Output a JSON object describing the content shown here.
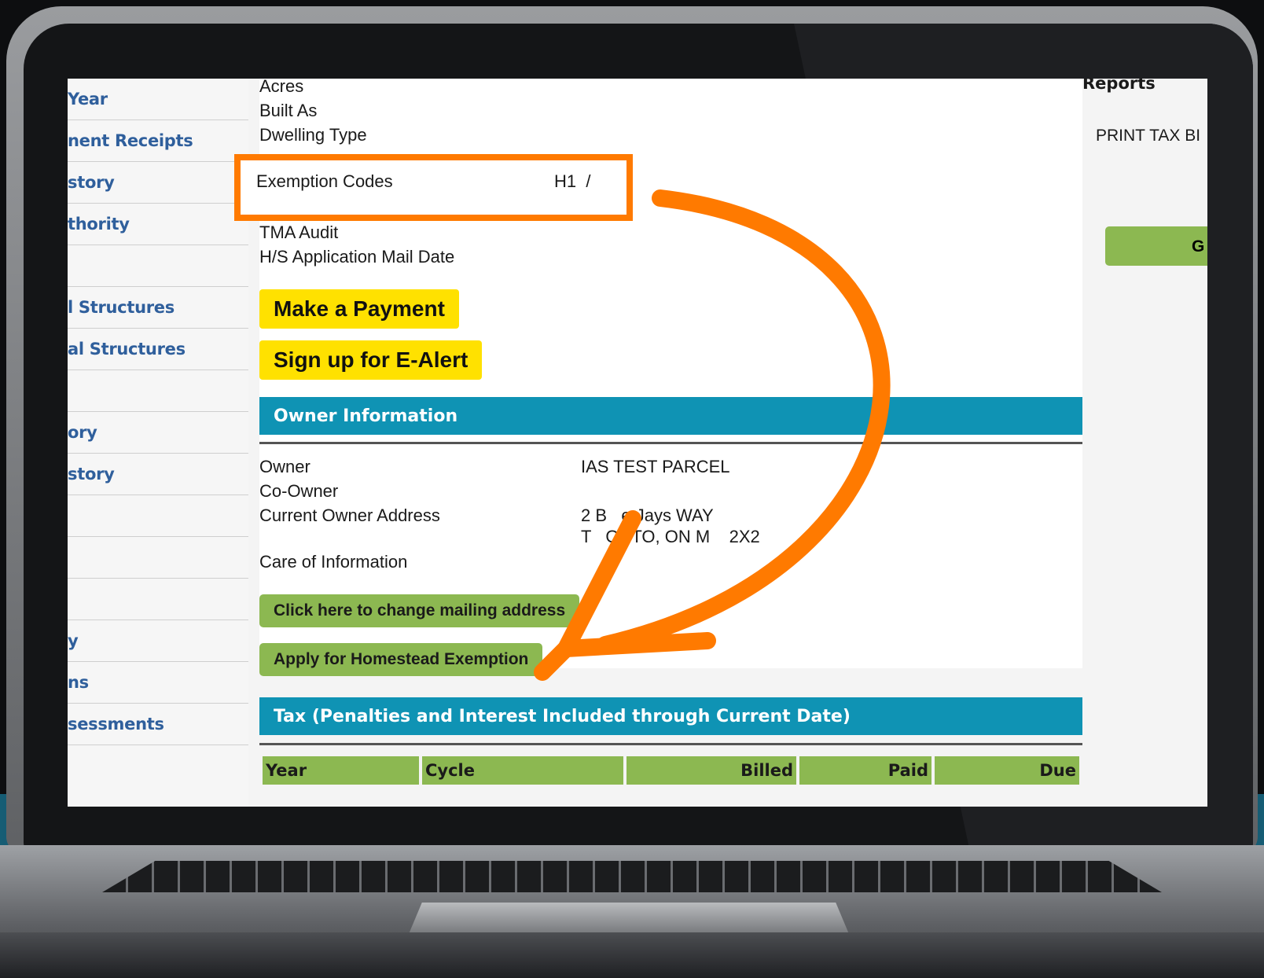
{
  "sidebar": {
    "items": [
      {
        "label": "Year"
      },
      {
        "label": "nent Receipts"
      },
      {
        "label": "story"
      },
      {
        "label": "thority"
      },
      {
        "label": ""
      },
      {
        "label": "l Structures"
      },
      {
        "label": "al Structures"
      },
      {
        "label": ""
      },
      {
        "label": "ory"
      },
      {
        "label": "story"
      },
      {
        "label": ""
      },
      {
        "label": ""
      },
      {
        "label": ""
      },
      {
        "label": "y"
      },
      {
        "label": "ns"
      },
      {
        "label": "sessments"
      }
    ]
  },
  "property": {
    "acres_label": "Acres",
    "built_as_label": "Built As",
    "dwelling_type_label": "Dwelling Type",
    "exemption_codes_label": "Exemption Codes",
    "exemption_codes_value": "H1  /",
    "tma_audit_label": "TMA Audit",
    "hs_mail_date_label": "H/S Application Mail Date"
  },
  "buttons": {
    "make_payment": "Make a Payment",
    "sign_up_ealert": "Sign up for E-Alert",
    "change_mailing": "Click here to change mailing address",
    "apply_homestead": "Apply for Homestead Exemption"
  },
  "owner": {
    "header": "Owner Information",
    "owner_label": "Owner",
    "owner_value": "IAS TEST PARCEL",
    "coowner_label": "Co-Owner",
    "address_label": "Current Owner Address",
    "address_line1": "2 B   e Jays WAY",
    "address_line2": "T   ONTO, ON M    2X2",
    "care_of_label": "Care of Information"
  },
  "tax": {
    "header": "Tax (Penalties and Interest Included through Current Date)",
    "columns": [
      "Year",
      "Cycle",
      "Billed",
      "Paid",
      "Due"
    ]
  },
  "right": {
    "reports_label": "Reports",
    "print_tax_bill": "PRINT TAX BI"
  },
  "colors": {
    "highlight": "#ff7a00",
    "section_header": "#0f93b4",
    "green_button": "#8cb851",
    "yellow_button": "#ffe100"
  }
}
